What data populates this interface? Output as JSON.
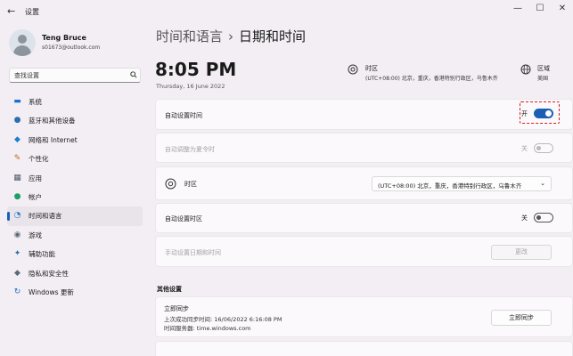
{
  "window": {
    "title": "设置",
    "back": "←",
    "minimize": "—",
    "maximize": "☐",
    "close": "✕"
  },
  "profile": {
    "name": "Teng Bruce",
    "email": "s01673@outlook.com"
  },
  "search": {
    "placeholder": "查找设置"
  },
  "sidebar": {
    "items": [
      {
        "label": "系统",
        "icon": "▬",
        "color": "#1a73c8"
      },
      {
        "label": "蓝牙和其他设备",
        "icon": "●",
        "color": "#2a6fb0"
      },
      {
        "label": "网络和 Internet",
        "icon": "◆",
        "color": "#1a7fd0"
      },
      {
        "label": "个性化",
        "icon": "✎",
        "color": "#c26a1a"
      },
      {
        "label": "应用",
        "icon": "▦",
        "color": "#4a5a6a"
      },
      {
        "label": "帐户",
        "icon": "●",
        "color": "#1aa06a"
      },
      {
        "label": "时间和语言",
        "icon": "◔",
        "color": "#1a73c8"
      },
      {
        "label": "游戏",
        "icon": "◉",
        "color": "#5a6a7a"
      },
      {
        "label": "辅助功能",
        "icon": "✦",
        "color": "#2a6fb0"
      },
      {
        "label": "隐私和安全性",
        "icon": "◆",
        "color": "#5a6a7a"
      },
      {
        "label": "Windows 更新",
        "icon": "↻",
        "color": "#1a73c8"
      }
    ],
    "active_index": 6
  },
  "breadcrumb": {
    "parent": "时间和语言",
    "separator": "›",
    "current": "日期和时间"
  },
  "clock": {
    "time": "8:05 PM",
    "date": "Thursday, 16 June 2022"
  },
  "timezone_summary": {
    "label": "时区",
    "value": "(UTC+08:00) 北京，重庆，香港特别行政区，乌鲁木齐"
  },
  "region_summary": {
    "label": "区域",
    "value": "美国"
  },
  "settings": {
    "auto_time": {
      "label": "自动设置时间",
      "state_label": "开",
      "on": true
    },
    "dst": {
      "label": "自动调整为夏令时",
      "state_label": "关",
      "on": false,
      "disabled": true
    },
    "timezone": {
      "label": "时区",
      "value": "(UTC+08:00) 北京，重庆，香港特别行政区，乌鲁木齐",
      "chevron": "⌄"
    },
    "auto_timezone": {
      "label": "自动设置时区",
      "state_label": "关",
      "on": false
    },
    "manual": {
      "label": "手动设置日期和时间",
      "button": "更改",
      "disabled": true
    }
  },
  "other": {
    "title": "其他设置",
    "sync": {
      "title": "立即同步",
      "last_sync": "上次成功同步时间: 16/06/2022 6:16:08 PM",
      "server": "时间服务器: time.windows.com",
      "button": "立即同步"
    }
  },
  "colors": {
    "accent": "#1a5fb4",
    "highlight": "#d62020"
  }
}
